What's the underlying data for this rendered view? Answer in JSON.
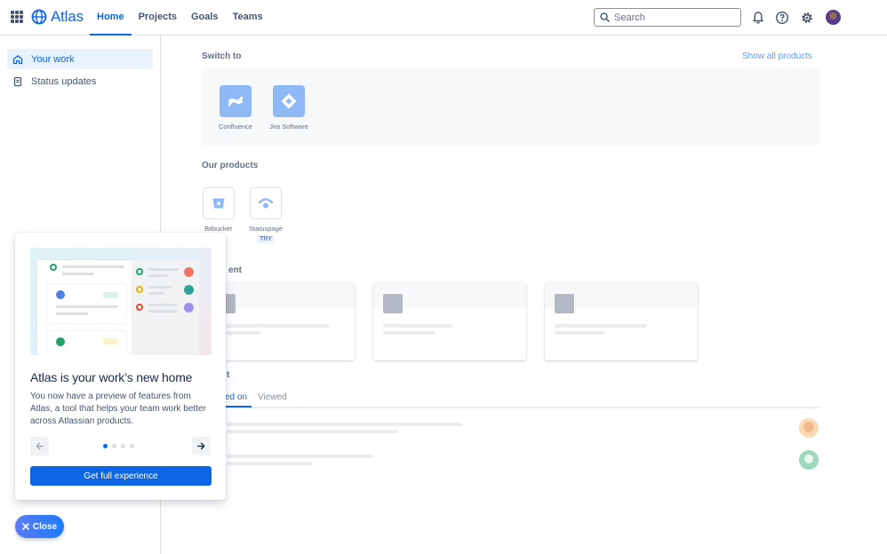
{
  "topbar": {
    "logo_text": "Atlas",
    "nav": [
      {
        "label": "Home",
        "active": true
      },
      {
        "label": "Projects",
        "active": false
      },
      {
        "label": "Goals",
        "active": false
      },
      {
        "label": "Teams",
        "active": false
      }
    ],
    "search_placeholder": "Search",
    "icons": [
      "notifications-icon",
      "help-icon",
      "settings-icon"
    ]
  },
  "sidebar": {
    "items": [
      {
        "label": "Your work",
        "icon": "home-icon",
        "active": true
      },
      {
        "label": "Status updates",
        "icon": "document-icon",
        "active": false
      }
    ]
  },
  "main": {
    "switch_to": {
      "label": "Switch to",
      "show_all": "Show all products",
      "products": [
        {
          "name": "Confluence",
          "icon": "confluence-icon"
        },
        {
          "name": "Jira Software",
          "icon": "jira-icon"
        }
      ]
    },
    "our_products": {
      "label": "Our products",
      "products": [
        {
          "name": "Bitbucket",
          "icon": "bitbucket-icon"
        },
        {
          "name": "Statuspage",
          "icon": "statuspage-icon",
          "badge": "TRY"
        }
      ]
    },
    "recent_label_fragment": "ent",
    "activity_label_fragment": "t",
    "tabs": [
      {
        "label": "ed on",
        "active": true
      },
      {
        "label": "Viewed",
        "active": false
      }
    ]
  },
  "spotlight": {
    "title": "Atlas is your work’s new home",
    "body": "You now have a preview of features from Atlas, a tool that helps your team work better across Atlassian products.",
    "total_steps": 4,
    "current_step": 1,
    "cta": "Get full experience"
  },
  "close_button": "Close",
  "colors": {
    "accent": "#0C66E4",
    "nav_active": "#0C66E4",
    "sidebar_active_bg": "#E9F2FF"
  }
}
